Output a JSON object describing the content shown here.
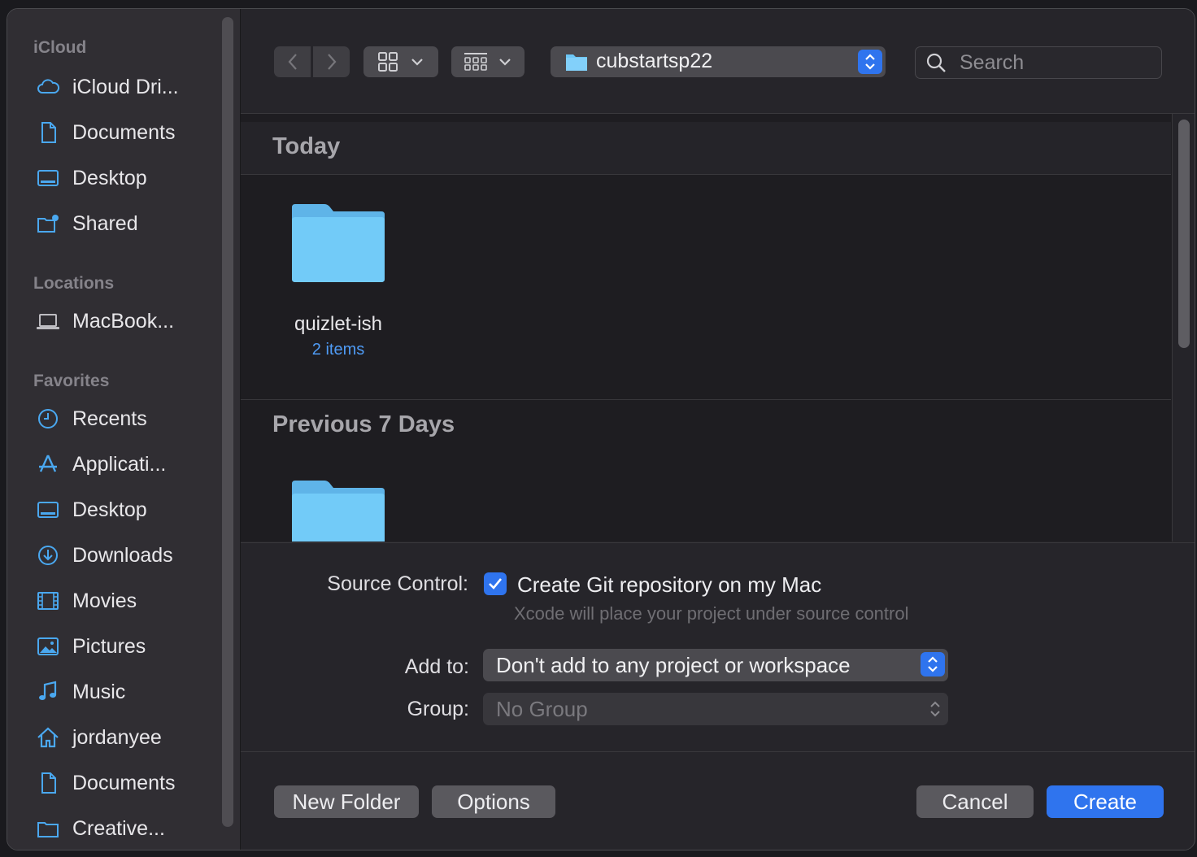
{
  "sidebar": {
    "icloud_header": "iCloud",
    "icloud_items": [
      {
        "label": "iCloud Dri...",
        "icon": "cloud-icon"
      },
      {
        "label": "Documents",
        "icon": "document-icon"
      },
      {
        "label": "Desktop",
        "icon": "desktop-icon"
      },
      {
        "label": "Shared",
        "icon": "shared-folder-icon"
      }
    ],
    "locations_header": "Locations",
    "locations_items": [
      {
        "label": "MacBook...",
        "icon": "laptop-icon"
      }
    ],
    "favorites_header": "Favorites",
    "favorites_items": [
      {
        "label": "Recents",
        "icon": "clock-icon"
      },
      {
        "label": "Applicati...",
        "icon": "applications-icon"
      },
      {
        "label": "Desktop",
        "icon": "desktop-icon"
      },
      {
        "label": "Downloads",
        "icon": "download-icon"
      },
      {
        "label": "Movies",
        "icon": "film-icon"
      },
      {
        "label": "Pictures",
        "icon": "photo-icon"
      },
      {
        "label": "Music",
        "icon": "music-note-icon"
      },
      {
        "label": "jordanyee",
        "icon": "home-icon"
      },
      {
        "label": "Documents",
        "icon": "document-icon"
      },
      {
        "label": "Creative...",
        "icon": "folder-icon"
      }
    ]
  },
  "toolbar": {
    "location": "cubstartsp22",
    "search_placeholder": "Search"
  },
  "files": {
    "sections": [
      {
        "title": "Today",
        "items": [
          {
            "name": "quizlet-ish",
            "count": "2 items"
          }
        ]
      },
      {
        "title": "Previous 7 Days",
        "items": [
          {
            "name": "",
            "count": ""
          }
        ]
      }
    ]
  },
  "options": {
    "source_control_label": "Source Control:",
    "git_checkbox_label": "Create Git repository on my Mac",
    "git_checked": true,
    "git_hint": "Xcode will place your project under source control",
    "add_to_label": "Add to:",
    "add_to_value": "Don't add to any project or workspace",
    "group_label": "Group:",
    "group_value": "No Group"
  },
  "buttons": {
    "new_folder": "New Folder",
    "options": "Options",
    "cancel": "Cancel",
    "create": "Create"
  },
  "colors": {
    "accent": "#2f74ee",
    "folder": "#6cc6f6",
    "link": "#4f9bf5"
  }
}
